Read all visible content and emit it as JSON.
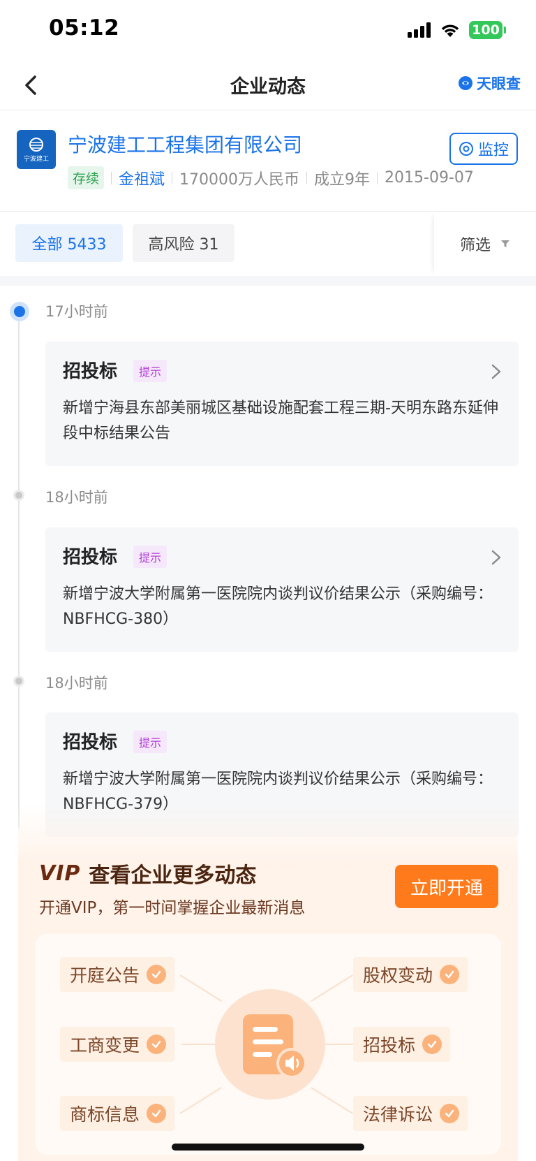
{
  "status_bar": {
    "time": "05:12",
    "battery": "100"
  },
  "nav": {
    "title": "企业动态",
    "brand": "天眼查"
  },
  "company": {
    "name": "宁波建工工程集团有限公司",
    "logo_text": "宁波建工",
    "status": "存续",
    "legal_person": "金祖斌",
    "capital": "170000万人民币",
    "age": "成立9年",
    "founded": "2015-09-07",
    "monitor_label": "监控"
  },
  "tabs": {
    "all_label": "全部 5433",
    "risk_label": "高风险 31",
    "filter_label": "筛选"
  },
  "events": [
    {
      "time": "17小时前",
      "type": "招投标",
      "tag": "提示",
      "text": "新增宁海县东部美丽城区基础设施配套工程三期-天明东路东延伸段中标结果公告"
    },
    {
      "time": "18小时前",
      "type": "招投标",
      "tag": "提示",
      "text": "新增宁波大学附属第一医院院内谈判议价结果公示（采购编号：NBFHCG-380）"
    },
    {
      "time": "18小时前",
      "type": "招投标",
      "tag": "提示",
      "text": "新增宁波大学附属第一医院院内谈判议价结果公示（采购编号：NBFHCG-379）"
    }
  ],
  "vip": {
    "badge": "VIP",
    "title": "查看企业更多动态",
    "subtitle": "开通VIP，第一时间掌握企业最新消息",
    "cta": "立即开通",
    "features": [
      "开庭公告",
      "工商变更",
      "商标信息",
      "股权变动",
      "招投标",
      "法律诉讼"
    ]
  },
  "colors": {
    "accent": "#1a73e8",
    "vip_orange": "#ff7a1a",
    "tag_purple": "#b13fd6",
    "status_green": "#2ea44f"
  }
}
